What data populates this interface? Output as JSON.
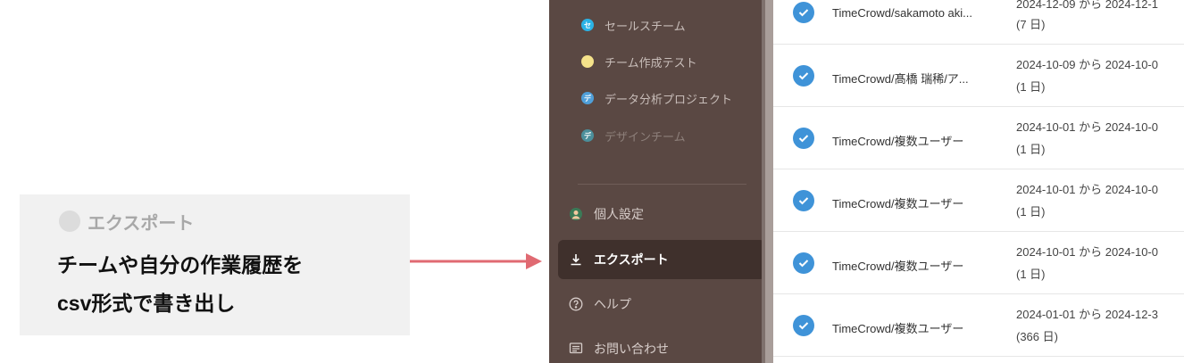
{
  "callout": {
    "title": "エクスポート",
    "description": "チームや自分の作業履歴を\ncsv形式で書き出し"
  },
  "sidebar": {
    "teams": [
      {
        "label": "セールスチーム",
        "icon_text": "セ",
        "icon_color": "#2bb3e6"
      },
      {
        "label": "チーム作成テスト",
        "icon_text": "",
        "icon_color": "#f5e28a"
      },
      {
        "label": "データ分析プロジェクト",
        "icon_text": "デ",
        "icon_color": "#4f9fd9"
      },
      {
        "label": "デザインチーム",
        "icon_text": "デ",
        "icon_color": "#4b8f9b"
      }
    ],
    "nav": {
      "personal_settings": "個人設定",
      "export": "エクスポート",
      "help": "ヘルプ",
      "contact": "お問い合わせ"
    }
  },
  "rows": [
    {
      "name": "TimeCrowd/sakamoto aki...",
      "range": "2024-12-09 から 2024-12-1",
      "days": "(7 日)"
    },
    {
      "name": "TimeCrowd/髙橋 瑞稀/ア...",
      "range": "2024-10-09 から 2024-10-0",
      "days": "(1 日)"
    },
    {
      "name": "TimeCrowd/複数ユーザー",
      "range": "2024-10-01 から 2024-10-0",
      "days": "(1 日)"
    },
    {
      "name": "TimeCrowd/複数ユーザー",
      "range": "2024-10-01 から 2024-10-0",
      "days": "(1 日)"
    },
    {
      "name": "TimeCrowd/複数ユーザー",
      "range": "2024-10-01 から 2024-10-0",
      "days": "(1 日)"
    },
    {
      "name": "TimeCrowd/複数ユーザー",
      "range": "2024-01-01 から 2024-12-3",
      "days": "(366 日)"
    }
  ],
  "colors": {
    "sidebar_bg": "#5a4843",
    "active_bg": "#3f302c",
    "check_blue": "#3f93d8",
    "arrow_red": "#e06a72"
  }
}
